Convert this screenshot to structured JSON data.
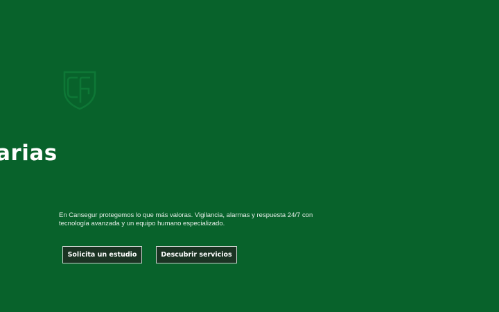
{
  "hero": {
    "headline_fragment": "arias",
    "description": "En Cansegur protegemos lo que más valoras. Vigilancia, alarmas y respuesta 24/7 con tecnología avanzada y un equipo humano especializado.",
    "logo_icon": "shield-monogram-icon",
    "colors": {
      "background": "#08622b",
      "button_bg": "#1b3323",
      "button_border": "#c9d3cc",
      "logo": "#0f7a38"
    }
  },
  "actions": {
    "primary_label": "Solicita un estudio",
    "secondary_label": "Descubrir servicios"
  }
}
